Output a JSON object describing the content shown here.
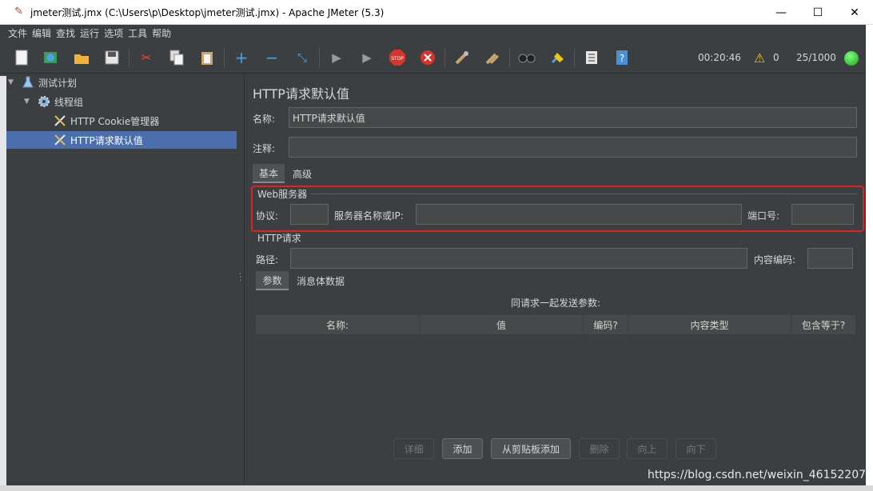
{
  "window": {
    "title": "jmeter测试.jmx (C:\\Users\\p\\Desktop\\jmeter测试.jmx) - Apache JMeter (5.3)",
    "minimize": "—",
    "maximize": "☐",
    "close": "✕"
  },
  "menu": [
    "文件",
    "编辑",
    "查找",
    "运行",
    "选项",
    "工具",
    "帮助"
  ],
  "toolbar": {
    "elapsed_time": "00:20:46",
    "warning_count": "0",
    "threads": "25/1000"
  },
  "tree": {
    "items": [
      {
        "label": "测试计划",
        "icon": "flask-icon"
      },
      {
        "label": "线程组",
        "icon": "gear-icon"
      },
      {
        "label": "HTTP Cookie管理器",
        "icon": "tools-icon"
      },
      {
        "label": "HTTP请求默认值",
        "icon": "tools-icon",
        "selected": true
      }
    ]
  },
  "panel": {
    "title": "HTTP请求默认值",
    "name_label": "名称:",
    "name_value": "HTTP请求默认值",
    "comment_label": "注释:",
    "comment_value": "",
    "tabs": [
      "基本",
      "高级"
    ],
    "web_server": {
      "group_title": "Web服务器",
      "protocol_label": "协议:",
      "protocol_value": "",
      "server_label": "服务器名称或IP:",
      "server_value": "",
      "port_label": "端口号:",
      "port_value": ""
    },
    "http_request": {
      "group_title": "HTTP请求",
      "path_label": "路径:",
      "path_value": "",
      "encoding_label": "内容编码:",
      "encoding_value": ""
    },
    "sub_tabs": [
      "参数",
      "消息体数据"
    ],
    "params_caption": "同请求一起发送参数:",
    "table_headers": [
      "名称:",
      "值",
      "编码?",
      "内容类型",
      "包含等于?"
    ],
    "buttons": [
      {
        "label": "详细",
        "enabled": false
      },
      {
        "label": "添加",
        "enabled": true
      },
      {
        "label": "从剪贴板添加",
        "enabled": true
      },
      {
        "label": "删除",
        "enabled": false
      },
      {
        "label": "向上",
        "enabled": false
      },
      {
        "label": "向下",
        "enabled": false
      }
    ]
  },
  "watermark": "https://blog.csdn.net/weixin_46152207",
  "colors": {
    "background": "#3c3f41",
    "selection": "#4b6eaf",
    "highlight_box": "#e0231f",
    "text": "#d6d6d6"
  }
}
